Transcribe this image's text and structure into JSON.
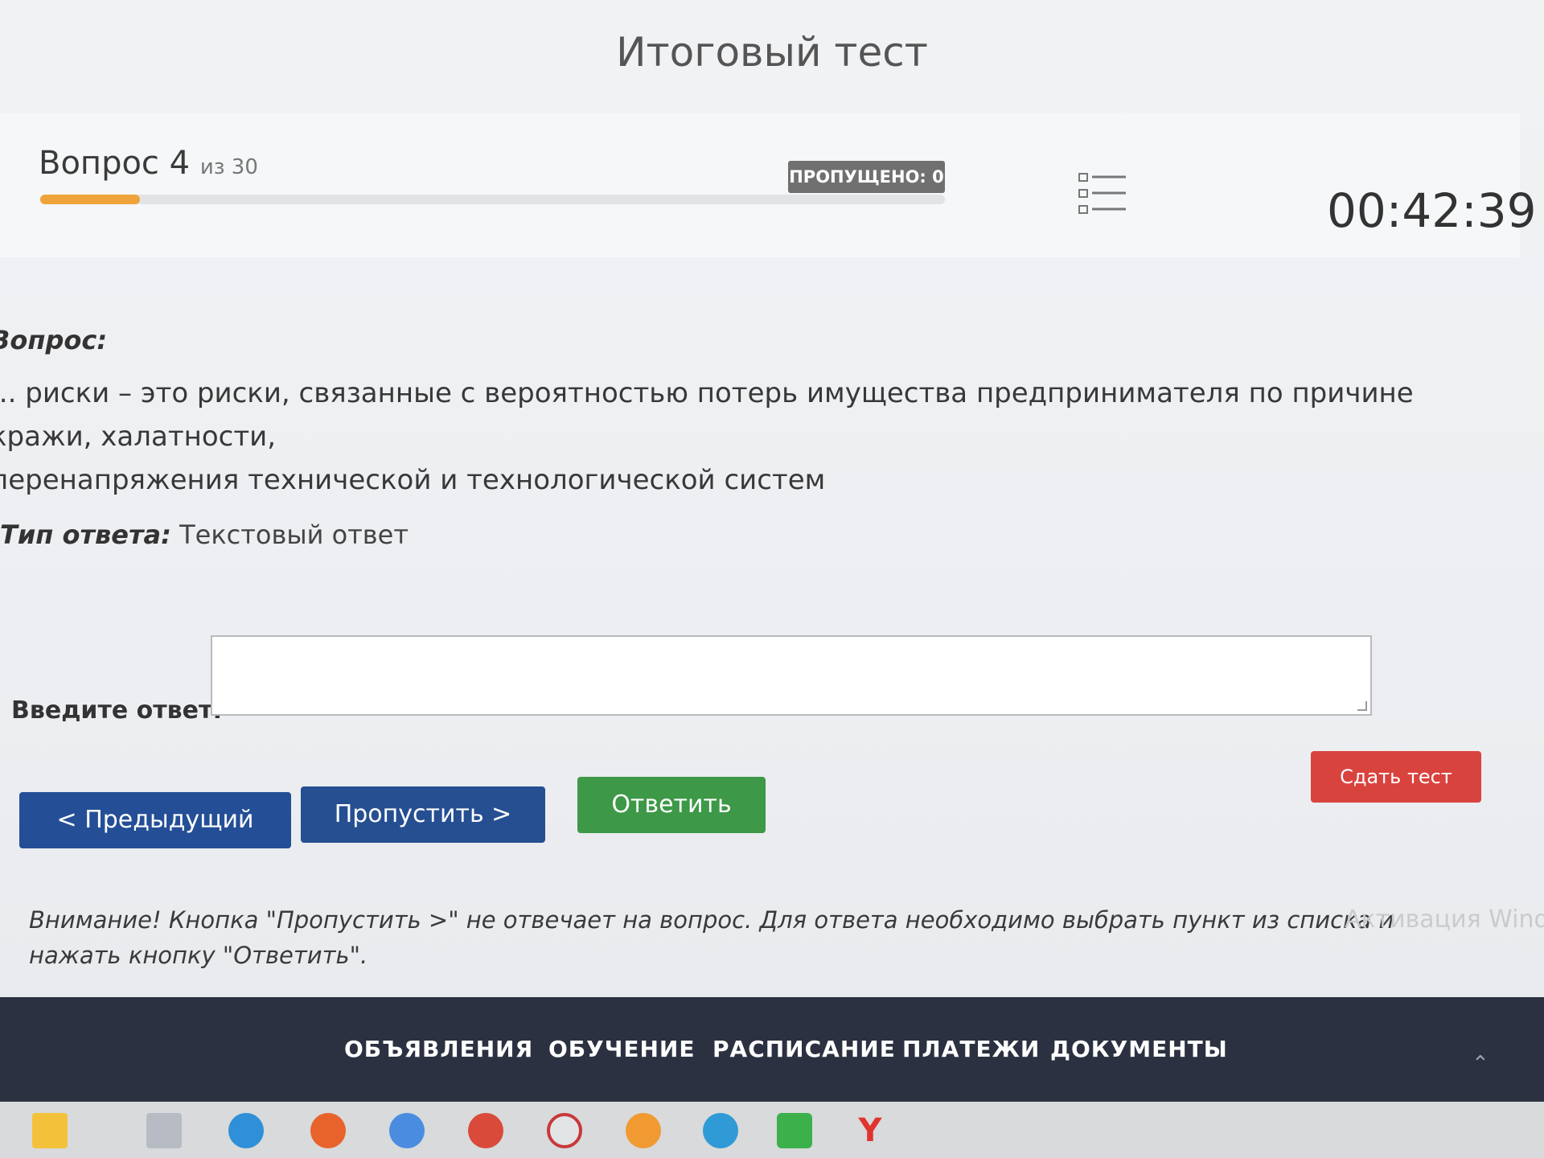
{
  "page": {
    "title": "Итоговый тест"
  },
  "header": {
    "question_label": "Вопрос 4",
    "question_of": "из 30",
    "progress": 0.11,
    "skipped_badge": "ПРОПУЩЕНО: 0",
    "timer": "00:42:39"
  },
  "question": {
    "heading": "Вопрос:",
    "text_line1": "... риски – это риски, связанные с вероятностью потерь имущества предпринимателя по причине кражи, халатности,",
    "text_line2": "перенапряжения технической и технологической систем"
  },
  "answer": {
    "type_label": "Тип ответа:",
    "type_value": "Текстовый ответ",
    "input_label": "Введите ответ:",
    "input_value": ""
  },
  "buttons": {
    "prev": "< Предыдущий",
    "skip": "Пропустить >",
    "answer": "Ответить",
    "submit": "Сдать тест"
  },
  "notice": {
    "text": "Внимание! Кнопка \"Пропустить >\" не отвечает на вопрос. Для ответа необходимо выбрать пункт из списка и нажать кнопку \"Ответить\"."
  },
  "watermark": {
    "text": "Активация Wind"
  },
  "footer_nav": {
    "items": [
      "ОБЪЯВЛЕНИЯ",
      "ОБУЧЕНИЕ",
      "РАСПИСАНИЕ",
      "ПЛАТЕЖИ",
      "ДОКУМЕНТЫ"
    ]
  },
  "taskbar": {
    "icons": [
      "start-icon",
      "file-explorer-icon",
      "edge-icon",
      "firefox-icon",
      "chromium-icon",
      "chrome-icon",
      "opera-icon",
      "mail-icon",
      "telegram-icon",
      "whatsapp-icon",
      "yandex-icon"
    ]
  },
  "colors": {
    "progress_fill": "#eea43a",
    "primary_button": "#244f96",
    "answer_button": "#3d9848",
    "submit_button": "#d9433e",
    "footer_bg": "#2b3140"
  }
}
